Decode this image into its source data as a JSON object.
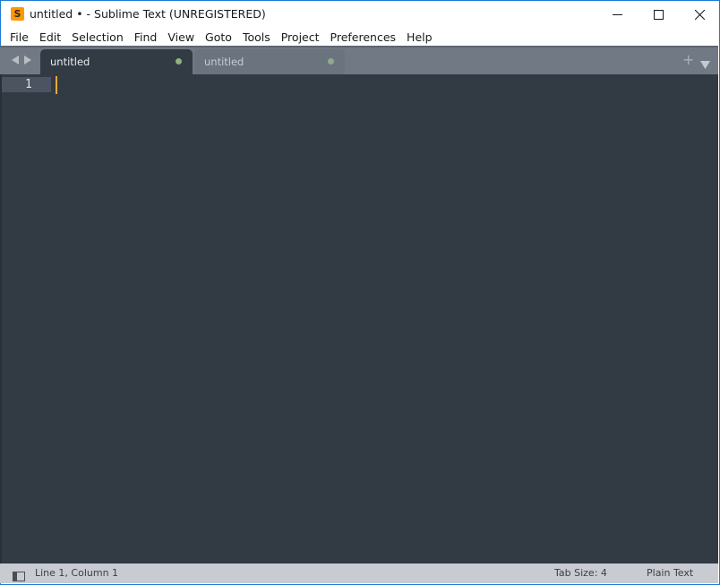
{
  "window": {
    "title": "untitled • - Sublime Text (UNREGISTERED)",
    "app_icon_glyph": "S",
    "accent_color": "#ff9800"
  },
  "menu": [
    "File",
    "Edit",
    "Selection",
    "Find",
    "View",
    "Goto",
    "Tools",
    "Project",
    "Preferences",
    "Help"
  ],
  "tabs": [
    {
      "label": "untitled",
      "active": true,
      "modified": true
    },
    {
      "label": "untitled",
      "active": false,
      "modified": true
    }
  ],
  "editor": {
    "line_numbers": [
      "1"
    ],
    "content": "",
    "cursor_color": "#f2a83a",
    "background": "#323a44"
  },
  "status": {
    "position": "Line 1, Column 1",
    "tab_size": "Tab Size: 4",
    "syntax": "Plain Text"
  },
  "icons": {
    "app": "sublime-text-icon",
    "minimize": "minimize-icon",
    "maximize": "maximize-icon",
    "close": "close-icon",
    "nav_back": "chevron-left-icon",
    "nav_forward": "chevron-right-icon",
    "new_tab": "plus-icon",
    "tab_menu": "triangle-down-icon",
    "side_panel": "side-panel-icon"
  }
}
